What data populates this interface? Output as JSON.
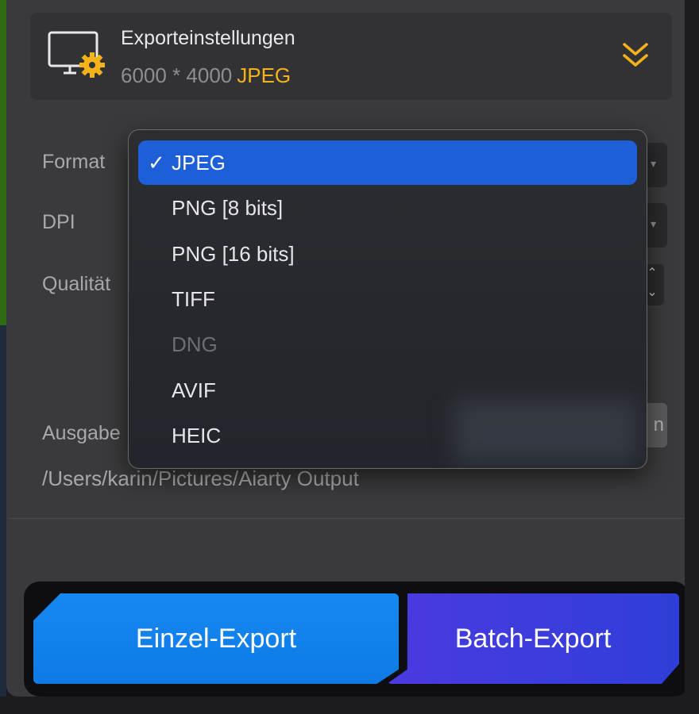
{
  "header": {
    "title": "Exporteinstellungen",
    "resolution": "6000 * 4000",
    "format": "JPEG"
  },
  "settings": {
    "format_label": "Format",
    "dpi_label": "DPI",
    "quality_label": "Qualität",
    "output_label": "Ausgabe",
    "browse_fragment": "n",
    "output_path": "/Users/karin/Pictures/Aiarty Output"
  },
  "format_menu": {
    "check_mark": "✓",
    "options": [
      {
        "label": "JPEG",
        "selected": true,
        "enabled": true
      },
      {
        "label": "PNG [8 bits]",
        "selected": false,
        "enabled": true
      },
      {
        "label": "PNG [16 bits]",
        "selected": false,
        "enabled": true
      },
      {
        "label": "TIFF",
        "selected": false,
        "enabled": true
      },
      {
        "label": "DNG",
        "selected": false,
        "enabled": false
      },
      {
        "label": "AVIF",
        "selected": false,
        "enabled": true
      },
      {
        "label": "HEIC",
        "selected": false,
        "enabled": true
      }
    ]
  },
  "actions": {
    "single_export": "Einzel-Export",
    "batch_export": "Batch-Export"
  },
  "colors": {
    "accent": "#f5b21b",
    "selection": "#1d5fd6",
    "single_button": "#1688f2",
    "batch_button": "#4b3ae0"
  }
}
